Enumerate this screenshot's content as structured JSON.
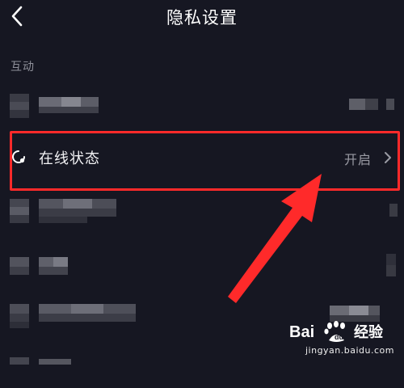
{
  "header": {
    "title": "隐私设置",
    "back_icon": "chevron-left-icon"
  },
  "section": {
    "label": "互动"
  },
  "online_status": {
    "label": "在线状态",
    "value": "开启",
    "icon": "online-status-icon",
    "chevron_icon": "chevron-right-icon"
  },
  "annotation": {
    "color": "#ff2a2a"
  },
  "watermark": {
    "logo_text": "Bai",
    "text": "经验",
    "url": "jingyan.baidu.com"
  },
  "colors": {
    "background": "#161722",
    "muted_text": "#8f909a",
    "value_text": "#9a9ba4"
  }
}
